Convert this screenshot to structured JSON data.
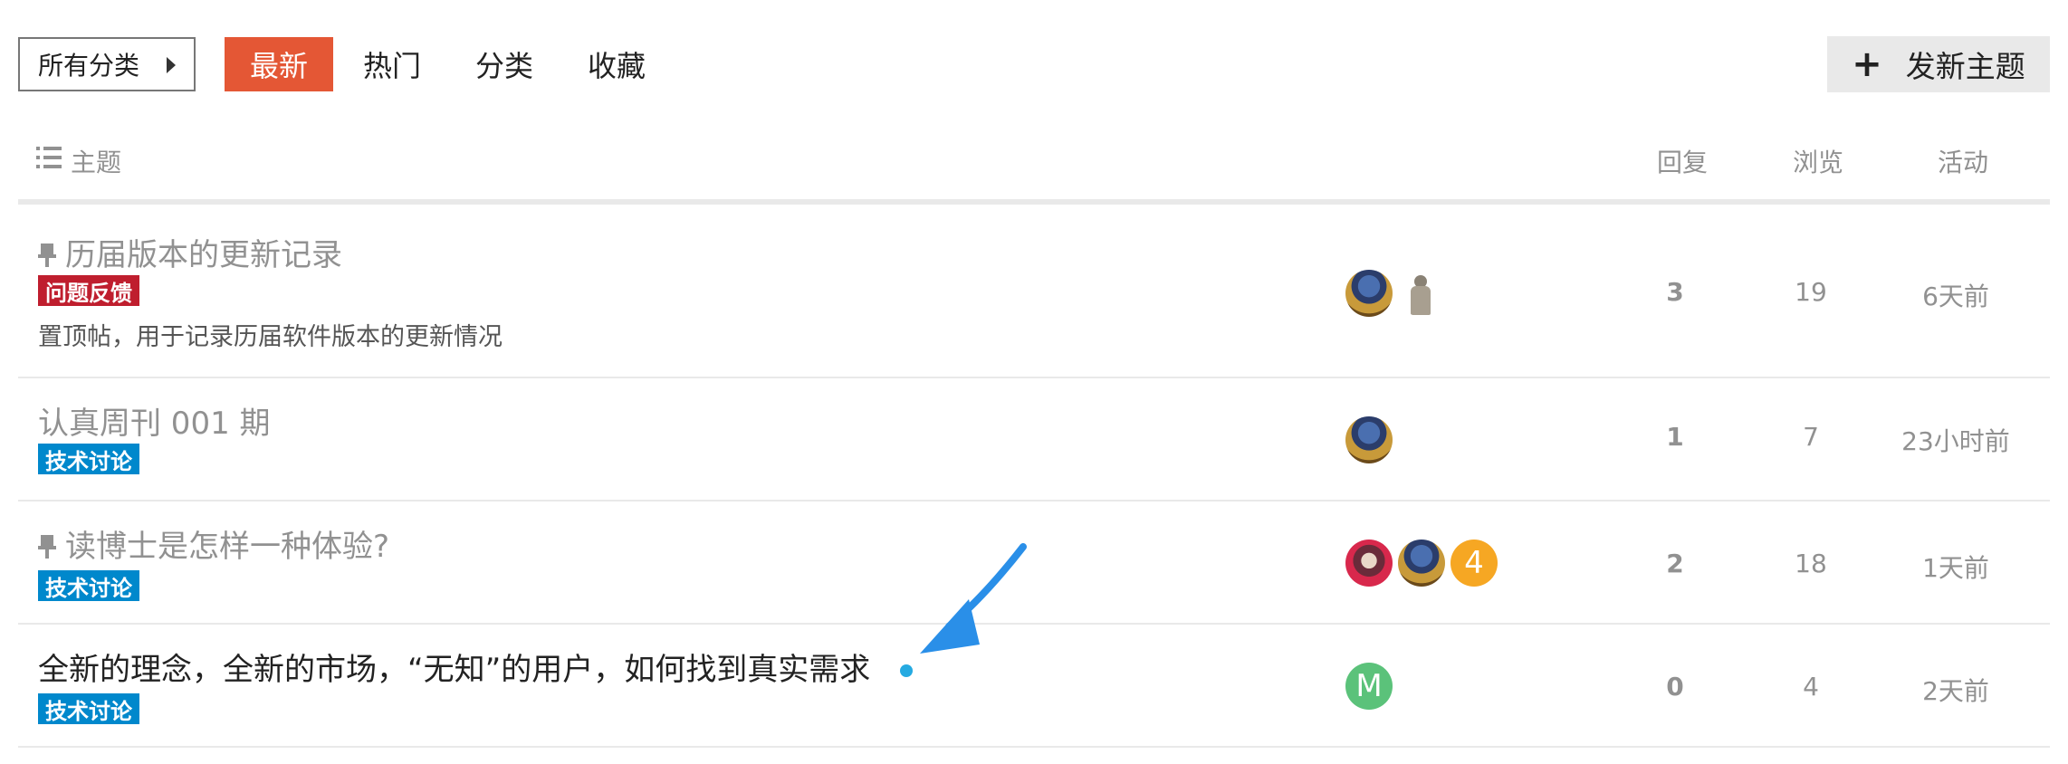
{
  "nav": {
    "category_dropdown": "所有分类",
    "tabs": [
      {
        "label": "最新",
        "active": true
      },
      {
        "label": "热门",
        "active": false
      },
      {
        "label": "分类",
        "active": false
      },
      {
        "label": "收藏",
        "active": false
      }
    ],
    "new_topic_label": "发新主题",
    "accent_color": "#e45735"
  },
  "table_header": {
    "topic": "主题",
    "replies": "回复",
    "views": "浏览",
    "activity": "活动"
  },
  "topics": [
    {
      "title": "历届版本的更新记录",
      "pinned": true,
      "category": "问题反馈",
      "category_color": "#bf1e2e",
      "excerpt": "置顶帖，用于记录历届软件版本的更新情况",
      "posters": [
        "knight-avatar",
        "statue-avatar"
      ],
      "replies": "3",
      "views": "19",
      "activity": "6天前"
    },
    {
      "title": "认真周刊 001 期",
      "pinned": false,
      "category": "技术讨论",
      "category_color": "#0088cc",
      "posters": [
        "knight-avatar"
      ],
      "replies": "1",
      "views": "7",
      "activity": "23小时前"
    },
    {
      "title": "读博士是怎样一种体验?",
      "pinned": true,
      "category": "技术讨论",
      "category_color": "#0088cc",
      "posters": [
        "red-avatar",
        "knight-avatar",
        "letter-avatar"
      ],
      "poster_letter": "4",
      "replies": "2",
      "views": "18",
      "activity": "1天前"
    },
    {
      "title": "全新的理念，全新的市场，“无知”的用户，如何找到真实需求",
      "pinned": false,
      "unread": true,
      "category": "技术讨论",
      "category_color": "#0088cc",
      "posters": [
        "letter-avatar"
      ],
      "poster_letter": "M",
      "replies": "0",
      "views": "4",
      "activity": "2天前"
    }
  ],
  "colors": {
    "unread_dot": "#25aae1",
    "annotation_arrow": "#2a8fe8"
  }
}
